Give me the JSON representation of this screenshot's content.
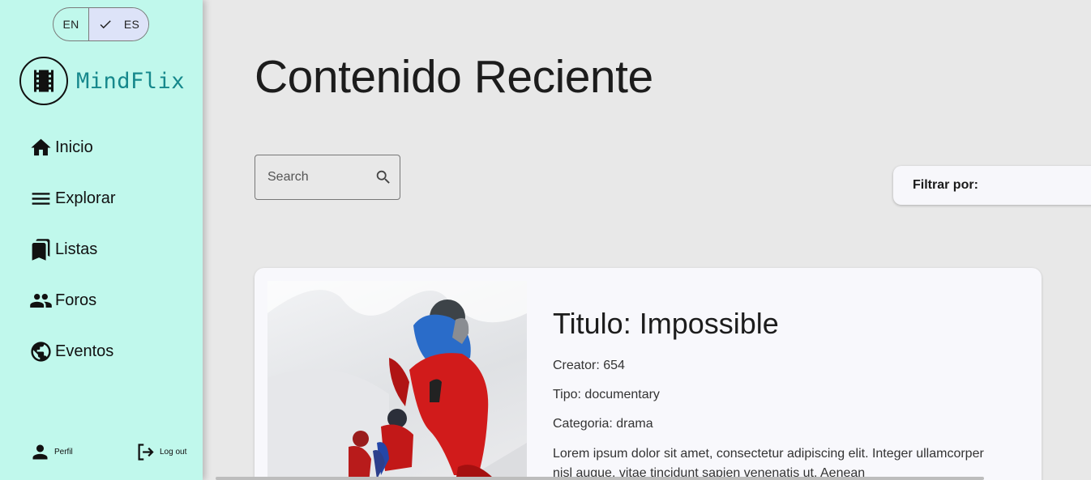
{
  "language": {
    "options": [
      "EN",
      "ES"
    ],
    "selected": "ES"
  },
  "brand": {
    "name": "MindFlix",
    "color": "#16888c"
  },
  "sidebar": {
    "background": "#c0f8ec",
    "items": [
      {
        "label": "Inicio",
        "icon": "home-icon"
      },
      {
        "label": "Explorar",
        "icon": "menu-icon"
      },
      {
        "label": "Listas",
        "icon": "bookmarks-icon"
      },
      {
        "label": "Foros",
        "icon": "people-icon"
      },
      {
        "label": "Eventos",
        "icon": "globe-icon"
      }
    ],
    "footer": {
      "profile_label": "Perfil",
      "logout_label": "Log out"
    }
  },
  "main": {
    "title": "Contenido Reciente",
    "search": {
      "placeholder": "Search"
    },
    "filter": {
      "label": "Filtrar por:"
    },
    "cards": [
      {
        "title": "Titulo: Impossible",
        "creator": "Creator: 654",
        "type": "Tipo: documentary",
        "category": "Categoria: drama",
        "description": "Lorem ipsum dolor sit amet, consectetur adipiscing elit. Integer ullamcorper nisl augue, vitae tincidunt sapien venenatis ut. Aenean"
      }
    ]
  }
}
